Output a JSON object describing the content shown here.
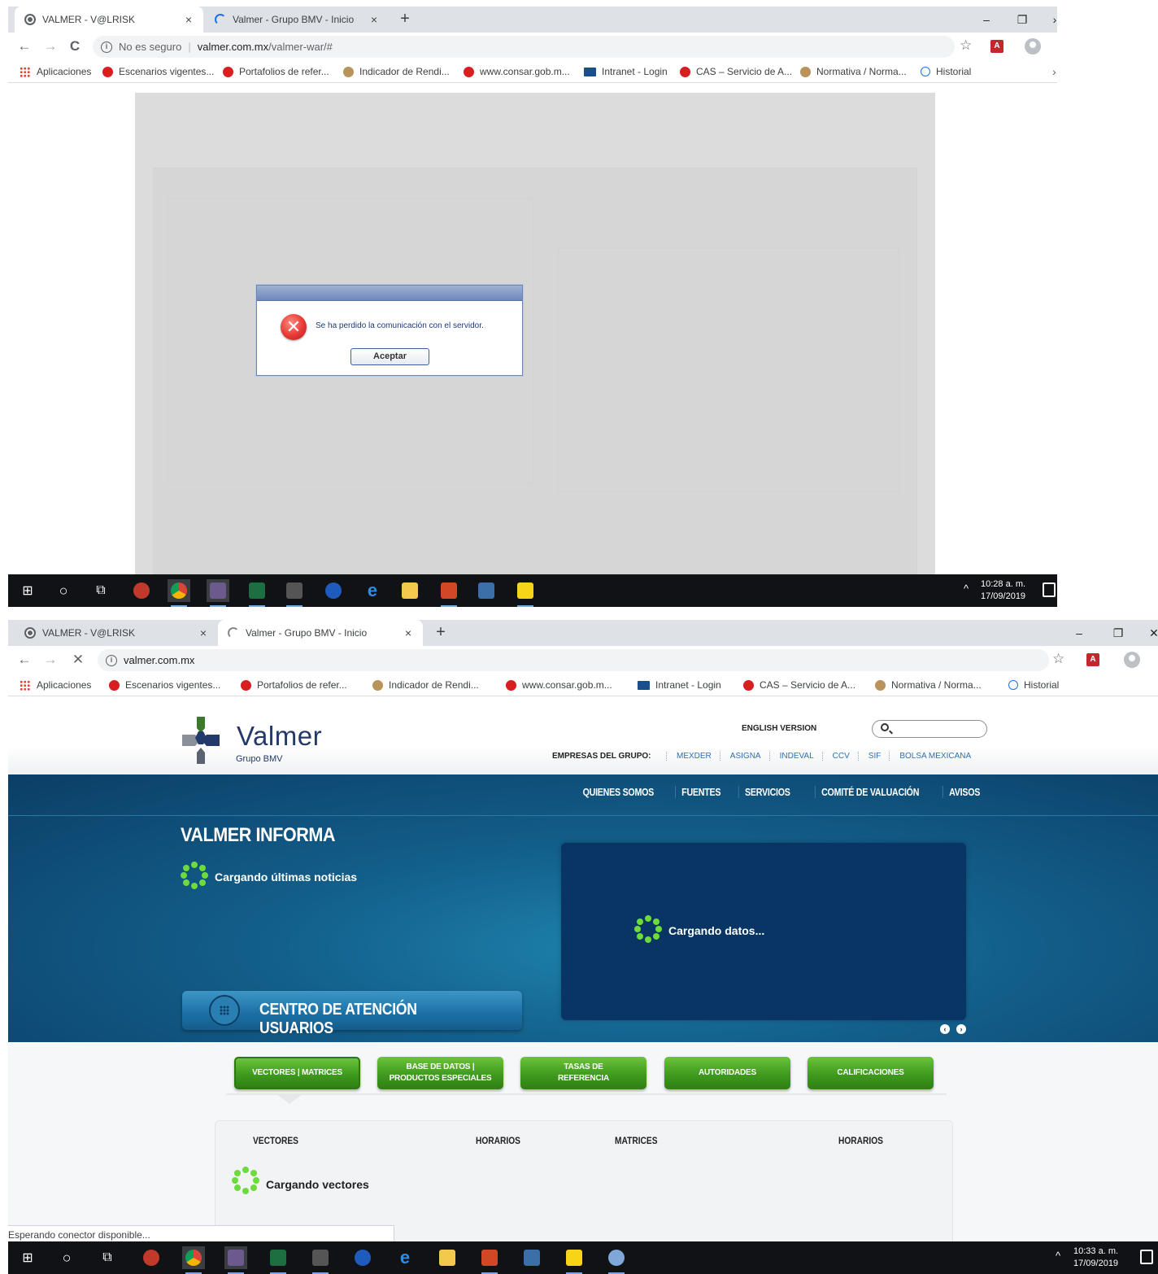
{
  "screen1": {
    "tabs": [
      {
        "title": "VALMER - V@LRISK",
        "close": "×"
      },
      {
        "title": "Valmer - Grupo BMV - Inicio",
        "close": "×"
      }
    ],
    "newtab": "+",
    "window_controls": [
      "–",
      "❐",
      "›"
    ],
    "nav": {
      "back": "←",
      "forward": "→",
      "reload": "C"
    },
    "address": {
      "security": "No es seguro",
      "separator": "|",
      "host": "valmer.com.mx",
      "path": "/valmer-war/#"
    },
    "dialog": {
      "message": "Se ha perdido la comunicación con el servidor.",
      "button": "Aceptar"
    },
    "clock": {
      "time": "10:28 a. m.",
      "date": "17/09/2019"
    }
  },
  "screen2": {
    "tabs": [
      {
        "title": "VALMER - V@LRISK",
        "close": "×"
      },
      {
        "title": "Valmer - Grupo BMV - Inicio",
        "close": "×"
      }
    ],
    "newtab": "+",
    "window_controls": [
      "–",
      "❐",
      "✕"
    ],
    "nav": {
      "back": "←",
      "forward": "→",
      "stop": "✕"
    },
    "address": {
      "url": "valmer.com.mx"
    },
    "clock": {
      "time": "10:33 a. m.",
      "date": "17/09/2019"
    },
    "status": "Esperando conector disponible..."
  },
  "bookmarks": [
    {
      "label": "Aplicaciones",
      "icon": "apps"
    },
    {
      "label": "Escenarios vigentes...",
      "icon": "red-dot"
    },
    {
      "label": "Portafolios de refer...",
      "icon": "red-dot"
    },
    {
      "label": "Indicador de Rendi...",
      "icon": "tan-dot"
    },
    {
      "label": "www.consar.gob.m...",
      "icon": "red-dot"
    },
    {
      "label": "Intranet - Login",
      "icon": "intranet"
    },
    {
      "label": "CAS – Servicio de A...",
      "icon": "red-dot"
    },
    {
      "label": "Normativa / Norma...",
      "icon": "tan-dot"
    },
    {
      "label": "Historial",
      "icon": "history"
    }
  ],
  "bookmarks_more": "›",
  "site": {
    "logo": {
      "name": "Valmer",
      "sub": "Grupo BMV"
    },
    "english": "ENGLISH VERSION",
    "empresas_label": "EMPRESAS DEL GRUPO:",
    "group_links": [
      "MEXDER",
      "ASIGNA",
      "INDEVAL",
      "CCV",
      "SIF",
      "BOLSA MEXICANA"
    ],
    "nav": [
      "QUIENES SOMOS",
      "FUENTES",
      "SERVICIOS",
      "COMITÉ DE VALUACIÓN",
      "AVISOS"
    ],
    "informa_title": "VALMER INFORMA",
    "news_loading": "Cargando últimas noticias",
    "data_loading": "Cargando datos...",
    "cau": "CENTRO DE ATENCIÓN USUARIOS",
    "carousel": {
      "prev": "‹",
      "next": "›"
    },
    "buttons": [
      "VECTORES  |  MATRICES",
      "BASE DE DATOS  |\nPRODUCTOS ESPECIALES",
      "TASAS DE\nREFERENCIA",
      "AUTORIDADES",
      "CALIFICACIONES"
    ],
    "columns": [
      "VECTORES",
      "HORARIOS",
      "MATRICES",
      "HORARIOS"
    ],
    "vectors_loading": "Cargando vectores"
  },
  "colors": {
    "accent_green": "#4aa625",
    "hero_blue": "#12608b",
    "brand_navy": "#23386b",
    "link_blue": "#2f6fb5"
  }
}
